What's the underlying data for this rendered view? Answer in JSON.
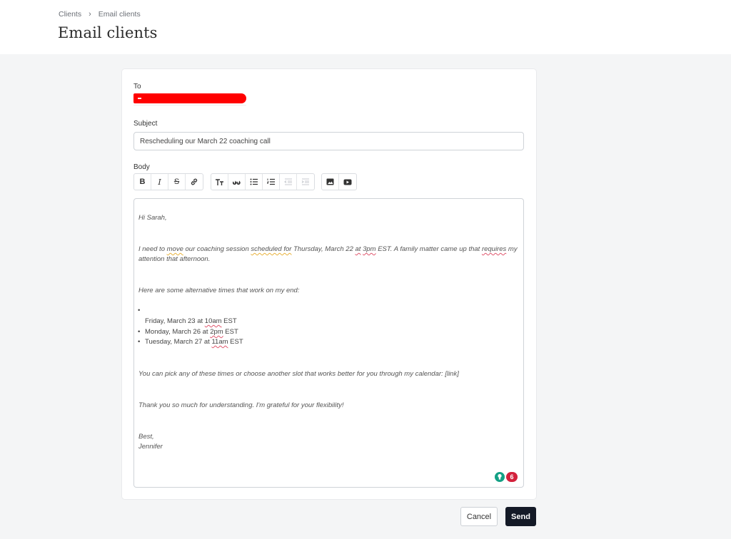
{
  "breadcrumb": {
    "items": [
      "Clients",
      "Email clients"
    ],
    "separator": "›"
  },
  "page": {
    "title": "Email clients"
  },
  "form": {
    "to_label": "To",
    "subject_label": "Subject",
    "subject_value": "Rescheduling our March 22 coaching call",
    "body_label": "Body"
  },
  "toolbar": {
    "groups": [
      [
        "bold-icon",
        "italic-icon",
        "strikethrough-icon",
        "link-icon"
      ],
      [
        "text-size-icon",
        "quote-icon",
        "bullet-list-icon",
        "numbered-list-icon",
        "outdent-icon",
        "indent-icon"
      ],
      [
        "image-icon",
        "video-icon"
      ]
    ],
    "bold": "B",
    "italic": "I",
    "strike": "S"
  },
  "body": {
    "greeting": "Hi Sarah,",
    "p1_line1": {
      "a": "I need to ",
      "move": "move",
      "b": " our coaching session ",
      "scheduled_for": "scheduled for",
      "c": " Thursday, March 22 ",
      "at": "at",
      "d": " ",
      "time": "3pm",
      "e": " EST. A family matter came up that ",
      "requires": "requires",
      "f": " my"
    },
    "p1_line2": "attention that afternoon.",
    "p2": "Here are some alternative times that work on my end:",
    "list": [
      {
        "pre": "Friday, March 23 at ",
        "time": "10am",
        "post": " EST"
      },
      {
        "pre": "Monday, March 26 at ",
        "time": "2pm",
        "post": " EST"
      },
      {
        "pre": "Tuesday, March 27 at ",
        "time": "11am",
        "post": " EST"
      }
    ],
    "p3": "You can pick any of these times or choose another slot that works better for you through my calendar: [link]",
    "p4": "Thank you so much for understanding. I'm grateful for your flexibility!",
    "signoff": "Best,",
    "name": "Jennifer"
  },
  "grammar_check": {
    "count": "6",
    "colors": {
      "bulb": "#14a085",
      "badge": "#d3213c"
    }
  },
  "actions": {
    "cancel": "Cancel",
    "send": "Send"
  },
  "colors": {
    "send_bg": "#141a27",
    "redaction": "#ff0000"
  }
}
